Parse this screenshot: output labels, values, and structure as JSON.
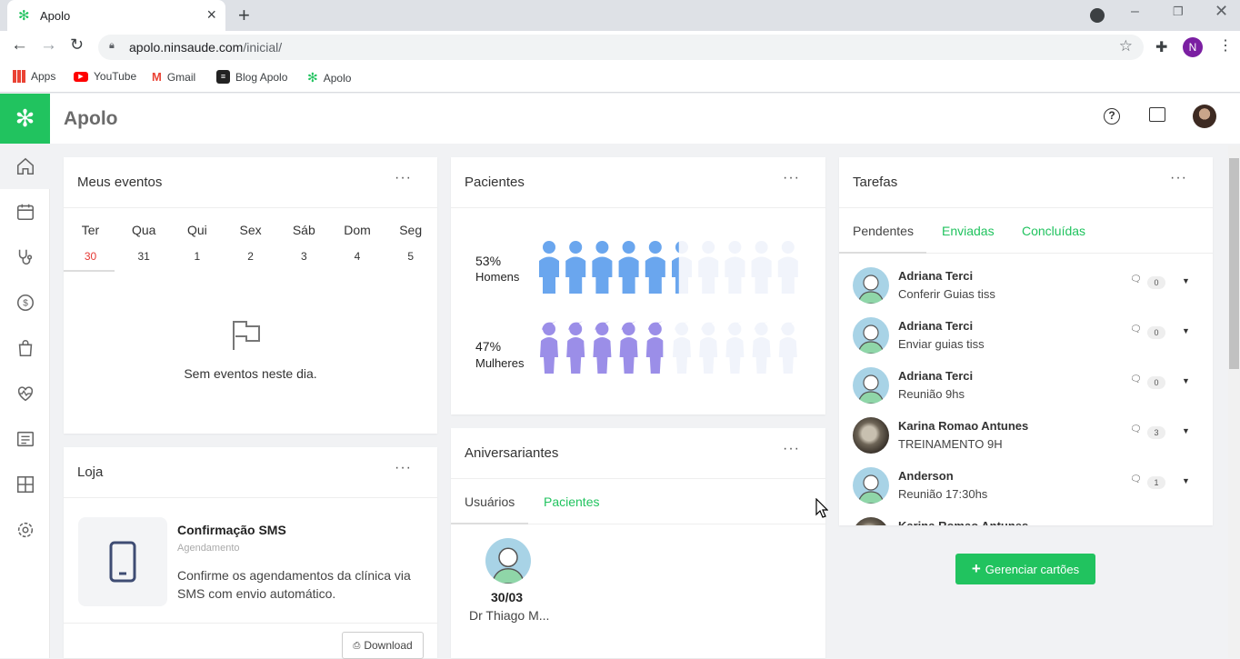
{
  "browser": {
    "tab_title": "Apolo",
    "url_host": "apolo.ninsaude.com",
    "url_path": "/inicial/",
    "profile_initial": "N",
    "bookmarks": [
      "Apps",
      "YouTube",
      "Gmail",
      "Blog Apolo",
      "Apolo"
    ]
  },
  "app": {
    "title": "Apolo",
    "brand_color": "#21c35f"
  },
  "eventos": {
    "title": "Meus eventos",
    "more": "···",
    "days": [
      {
        "name": "Ter",
        "num": "30"
      },
      {
        "name": "Qua",
        "num": "31"
      },
      {
        "name": "Qui",
        "num": "1"
      },
      {
        "name": "Sex",
        "num": "2"
      },
      {
        "name": "Sáb",
        "num": "3"
      },
      {
        "name": "Dom",
        "num": "4"
      },
      {
        "name": "Seg",
        "num": "5"
      }
    ],
    "empty": "Sem eventos neste dia."
  },
  "loja": {
    "title": "Loja",
    "more": "···",
    "item_title": "Confirmação SMS",
    "item_cat": "Agendamento",
    "item_desc": "Confirme os agendamentos da clínica via SMS com envio automático.",
    "download": "Download"
  },
  "pacientes": {
    "title": "Pacientes",
    "more": "···",
    "men_pct": "53%",
    "men_label": "Homens",
    "women_pct": "47%",
    "women_label": "Mulheres",
    "men_color": "#6aa6ee",
    "women_color": "#9b8ee8"
  },
  "aniversariantes": {
    "title": "Aniversariantes",
    "more": "···",
    "tabs": [
      "Usuários",
      "Pacientes"
    ],
    "date": "30/03",
    "name": "Dr Thiago M..."
  },
  "tarefas": {
    "title": "Tarefas",
    "more": "···",
    "tabs": [
      "Pendentes",
      "Enviadas",
      "Concluídas"
    ],
    "items": [
      {
        "name": "Adriana Terci",
        "desc": "Conferir Guias tiss",
        "count": "0"
      },
      {
        "name": "Adriana Terci",
        "desc": "Enviar guias tiss",
        "count": "0"
      },
      {
        "name": "Adriana Terci",
        "desc": "Reunião 9hs",
        "count": "0"
      },
      {
        "name": "Karina Romao Antunes",
        "desc": "TREINAMENTO 9H",
        "count": "3"
      },
      {
        "name": "Anderson",
        "desc": "Reunião 17:30hs",
        "count": "1"
      },
      {
        "name": "Karina Romao Antunes",
        "desc": "",
        "count": ""
      }
    ],
    "manage": "Gerenciar cartões"
  }
}
